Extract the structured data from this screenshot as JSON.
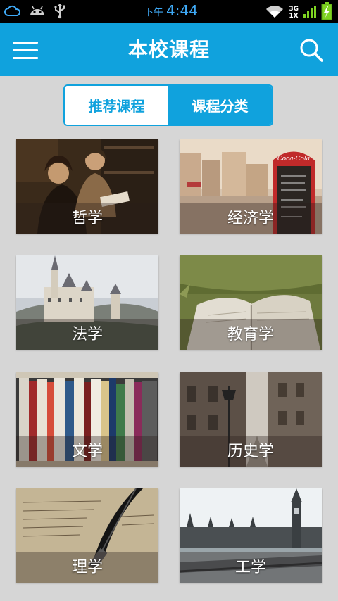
{
  "status_bar": {
    "ampm": "下午",
    "time": "4:44",
    "network_type_top": "3G",
    "network_type_bottom": "1X",
    "icons": [
      "cloud-icon",
      "android-icon",
      "usb-icon",
      "wifi-icon",
      "signal-icon",
      "battery-icon"
    ]
  },
  "header": {
    "title": "本校课程",
    "menu_icon": "hamburger-menu-icon",
    "search_icon": "search-icon"
  },
  "tabs": [
    {
      "label": "推荐课程",
      "active": true
    },
    {
      "label": "课程分类",
      "active": false
    }
  ],
  "courses": [
    {
      "label": "哲学"
    },
    {
      "label": "经济学"
    },
    {
      "label": "法学"
    },
    {
      "label": "教育学"
    },
    {
      "label": "文学"
    },
    {
      "label": "历史学"
    },
    {
      "label": "理学"
    },
    {
      "label": "工学"
    }
  ],
  "colors": {
    "accent": "#10a2dd",
    "background": "#d6d6d6",
    "status_bar": "#000000",
    "clock": "#3fa9f5",
    "battery": "#7ed321"
  }
}
